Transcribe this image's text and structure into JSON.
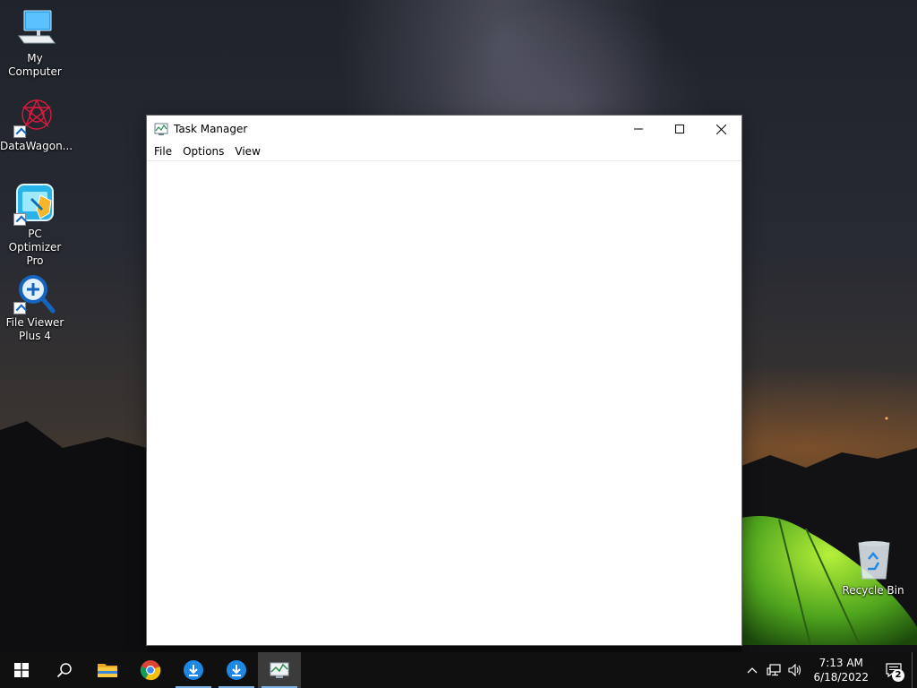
{
  "desktop": {
    "icons": [
      {
        "label": "My Computer"
      },
      {
        "label": "DataWagon..."
      },
      {
        "label": "PC Optimizer Pro"
      },
      {
        "label": "File Viewer Plus 4"
      },
      {
        "label": "Recycle Bin"
      }
    ]
  },
  "window": {
    "title": "Task Manager",
    "menu": [
      "File",
      "Options",
      "View"
    ]
  },
  "taskbar": {
    "apps": [
      {
        "name": "start",
        "icon": "windows-logo-icon"
      },
      {
        "name": "search",
        "icon": "search-icon"
      },
      {
        "name": "file-explorer",
        "icon": "folder-icon"
      },
      {
        "name": "chrome",
        "icon": "chrome-icon"
      },
      {
        "name": "download-1",
        "icon": "download-icon"
      },
      {
        "name": "download-2",
        "icon": "download-icon"
      },
      {
        "name": "task-manager",
        "icon": "task-manager-icon",
        "active": true
      }
    ],
    "tray": {
      "time": "7:13 AM",
      "date": "6/18/2022",
      "notifications": "2"
    }
  },
  "colors": {
    "taskbar": "#101010",
    "accent": "#7fb3e8",
    "close_hover": "#e81123"
  }
}
